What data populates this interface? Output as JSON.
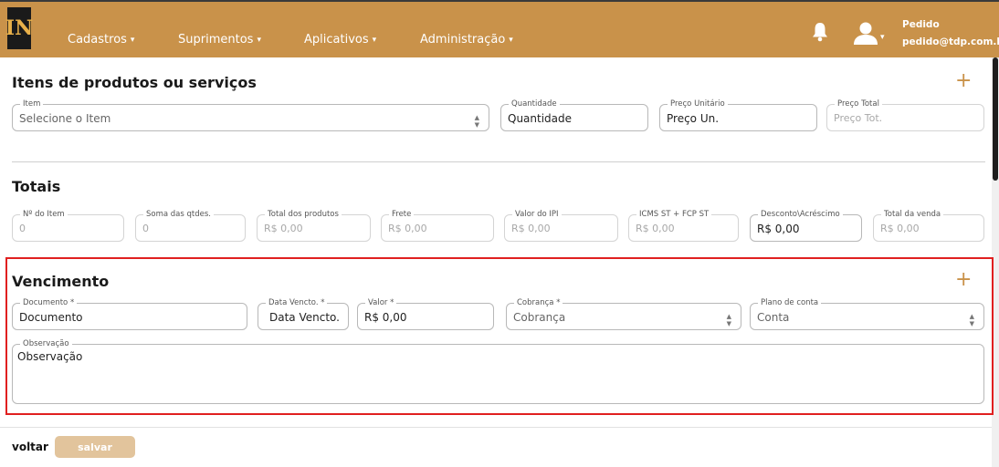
{
  "brand": {
    "logo_text": "IN",
    "accent": "#c9924a"
  },
  "nav": {
    "items": [
      {
        "label": "Cadastros"
      },
      {
        "label": "Suprimentos"
      },
      {
        "label": "Aplicativos"
      },
      {
        "label": "Administração"
      }
    ],
    "caret": "▾"
  },
  "user": {
    "name": "Pedido",
    "email": "pedido@tdp.com.br"
  },
  "itens": {
    "title": "Itens de produtos ou serviços",
    "add_icon": "+",
    "fields": {
      "item": {
        "label": "Item",
        "placeholder": "Selecione o Item"
      },
      "quantidade": {
        "label": "Quantidade",
        "placeholder": "Quantidade"
      },
      "preco_unitario": {
        "label": "Preço Unitário",
        "placeholder": "Preço Un."
      },
      "preco_total": {
        "label": "Preço Total",
        "placeholder": "Preço Tot."
      }
    }
  },
  "totais": {
    "title": "Totais",
    "fields": [
      {
        "label": "Nº do Item",
        "value": "0"
      },
      {
        "label": "Soma das qtdes.",
        "value": "0"
      },
      {
        "label": "Total dos produtos",
        "value": "R$ 0,00"
      },
      {
        "label": "Frete",
        "value": "R$ 0,00"
      },
      {
        "label": "Valor do IPI",
        "value": "R$ 0,00"
      },
      {
        "label": "ICMS ST + FCP ST",
        "value": "R$ 0,00"
      },
      {
        "label": "Desconto\\Acréscimo",
        "value": "R$ 0,00"
      },
      {
        "label": "Total da venda",
        "value": "R$ 0,00"
      }
    ]
  },
  "vencimento": {
    "title": "Vencimento",
    "add_icon": "+",
    "fields": {
      "documento": {
        "label": "Documento *",
        "placeholder": "Documento"
      },
      "data_vencto": {
        "label": "Data Vencto. *",
        "placeholder": "Data Vencto."
      },
      "valor": {
        "label": "Valor *",
        "value": "R$ 0,00"
      },
      "cobranca": {
        "label": "Cobrança *",
        "placeholder": "Cobrança"
      },
      "plano_conta": {
        "label": "Plano de conta",
        "placeholder": "Conta"
      },
      "observacao": {
        "label": "Observação",
        "placeholder": "Observação"
      }
    }
  },
  "footer": {
    "voltar": "voltar",
    "salvar": "salvar"
  }
}
